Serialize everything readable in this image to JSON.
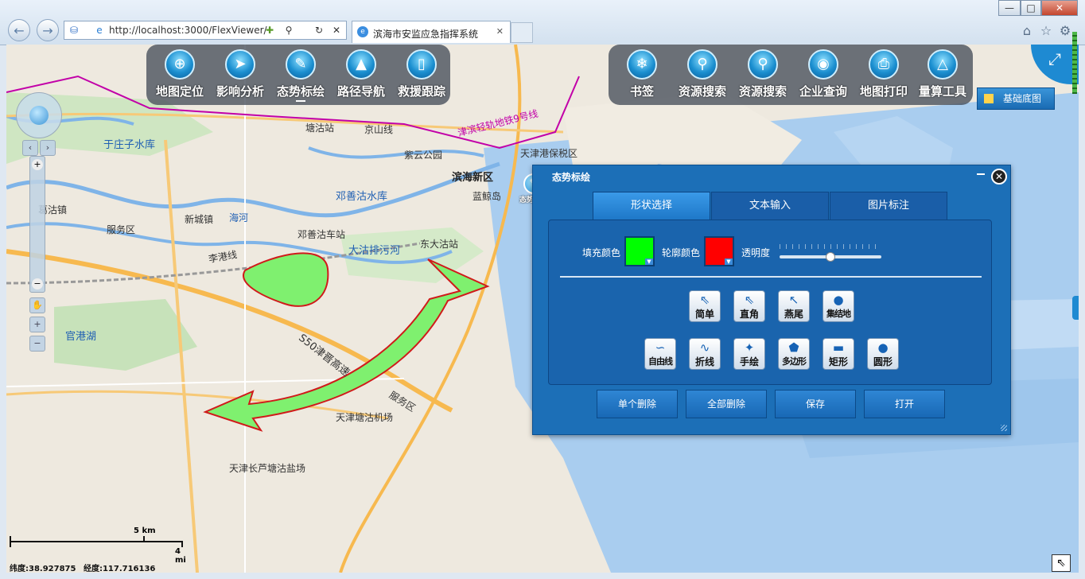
{
  "browser": {
    "url": "http://localhost:3000/FlexViewer/",
    "tab_title": "滨海市安监应急指挥系统",
    "back_icon": "back-arrow-icon",
    "forward_icon": "forward-arrow-icon",
    "window_buttons": {
      "minimize": "—",
      "maximize": "□",
      "close": "✕"
    }
  },
  "toolbar_left": {
    "items": [
      {
        "label": "地图定位",
        "icon": "crosshair-icon"
      },
      {
        "label": "影响分析",
        "icon": "pointer-icon"
      },
      {
        "label": "态势标绘",
        "icon": "draw-map-icon"
      },
      {
        "label": "路径导航",
        "icon": "navigation-arrow-icon"
      },
      {
        "label": "救援跟踪",
        "icon": "phone-icon"
      }
    ]
  },
  "toolbar_right": {
    "items": [
      {
        "label": "书签",
        "icon": "maple-leaf-icon"
      },
      {
        "label": "资源搜索",
        "icon": "search-map-icon"
      },
      {
        "label": "资源搜索",
        "icon": "search-map-icon"
      },
      {
        "label": "企业查询",
        "icon": "camera-icon"
      },
      {
        "label": "地图打印",
        "icon": "printer-icon"
      },
      {
        "label": "量算工具",
        "icon": "ruler-triangle-icon"
      }
    ]
  },
  "basemap_button": "基础底图",
  "map_labels": {
    "yzz": "于庄子水库",
    "tangguzhan": "塘沽站",
    "jingshan": "京山线",
    "metro9": "津滨轻轨地铁9号线",
    "ziyun": "紫云公园",
    "bonded": "天津港保税区",
    "binhai": "滨海新区",
    "lanjing": "蓝鲸岛",
    "dengshan_res": "邓善沽水库",
    "gegu": "葛沽镇",
    "xincheng": "新城镇",
    "haihe": "海河",
    "fuwuqu1": "服务区",
    "dengshan_stn": "邓善沽车站",
    "dagu_paiwu": "大沽排污河",
    "donggu": "东大沽站",
    "lishi": "李港线",
    "guangang": "官港湖",
    "s50": "S50津晋高速",
    "fuwuqu2": "服务区",
    "airport": "天津塘沽机场",
    "changlu": "天津长芦塘沽盐场"
  },
  "panel": {
    "title": "态势标绘",
    "marker_label": "态势标绘",
    "tabs": [
      "形状选择",
      "文本输入",
      "图片标注"
    ],
    "fill_label": "填充颜色",
    "outline_label": "轮廓颜色",
    "opacity_label": "透明度",
    "opacity_value": 0.5,
    "fill_color": "#00ff00",
    "outline_color": "#ff0000",
    "shapes_row1": [
      {
        "label": "简单",
        "icon": "simple-arrow-icon"
      },
      {
        "label": "直角",
        "icon": "right-angle-arrow-icon"
      },
      {
        "label": "燕尾",
        "icon": "swallowtail-arrow-icon"
      },
      {
        "label": "集结地",
        "icon": "assembly-area-icon"
      }
    ],
    "shapes_row2": [
      {
        "label": "自由线",
        "icon": "freehand-line-icon"
      },
      {
        "label": "折线",
        "icon": "polyline-icon"
      },
      {
        "label": "手绘",
        "icon": "freehand-arrow-icon"
      },
      {
        "label": "多边形",
        "icon": "polygon-icon"
      },
      {
        "label": "矩形",
        "icon": "rectangle-icon"
      },
      {
        "label": "圆形",
        "icon": "circle-icon"
      }
    ],
    "buttons": [
      "单个删除",
      "全部删除",
      "保存",
      "打开"
    ]
  },
  "scale_bar": {
    "km": "5 km",
    "mi": "4 mi"
  },
  "coordinates": {
    "lat_label": "纬度:",
    "lat": "38.927875",
    "lon_label": "经度:",
    "lon": "117.716136"
  }
}
